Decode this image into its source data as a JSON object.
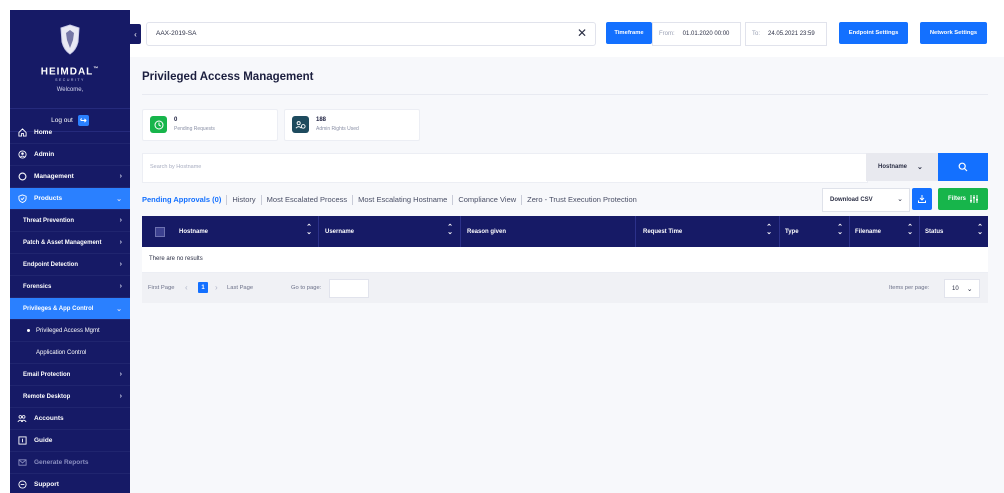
{
  "sidebar": {
    "brand": "HEIMDAL",
    "brand_tm": "™",
    "brand_sub": "SECURITY",
    "welcome": "Welcome,",
    "logout": "Log out",
    "items": [
      {
        "label": "Home",
        "icon": "home-icon"
      },
      {
        "label": "Admin",
        "icon": "admin-icon"
      },
      {
        "label": "Management",
        "icon": "management-icon"
      },
      {
        "label": "Products",
        "icon": "shield-icon"
      },
      {
        "label": "Threat Prevention"
      },
      {
        "label": "Patch & Asset Management"
      },
      {
        "label": "Endpoint Detection"
      },
      {
        "label": "Forensics"
      },
      {
        "label": "Privileges & App Control"
      },
      {
        "label": "Privileged Access Mgmt"
      },
      {
        "label": "Application Control"
      },
      {
        "label": "Email Protection"
      },
      {
        "label": "Remote Desktop"
      },
      {
        "label": "Accounts",
        "icon": "accounts-icon"
      },
      {
        "label": "Guide",
        "icon": "guide-icon"
      },
      {
        "label": "Generate Reports",
        "icon": "mail-icon"
      },
      {
        "label": "Support",
        "icon": "chat-icon"
      }
    ]
  },
  "topbar": {
    "hostname_value": "AAX-2019-SA",
    "timeframe": "Timeframe",
    "from_label": "From:",
    "from_value": "01.01.2020 00:00",
    "to_label": "To:",
    "to_value": "24.05.2021 23:59",
    "endpoint_settings": "Endpoint Settings",
    "network_settings": "Network Settings"
  },
  "page": {
    "title": "Privileged Access Management"
  },
  "stats": [
    {
      "value": "0",
      "label": "Pending Requests",
      "color": "#17b54b"
    },
    {
      "value": "188",
      "label": "Admin Rights Used",
      "color": "#1e4b5e"
    }
  ],
  "search": {
    "placeholder": "Search by Hostname",
    "field": "Hostname"
  },
  "tabs": [
    "Pending Approvals (0)",
    "History",
    "Most Escalated Process",
    "Most Escalating Hostname",
    "Compliance View",
    "Zero - Trust Execution Protection"
  ],
  "actions": {
    "download_csv": "Download CSV",
    "filters": "Filters"
  },
  "table": {
    "columns": [
      "Hostname",
      "Username",
      "Reason given",
      "Request Time",
      "Type",
      "Filename",
      "Status"
    ],
    "empty": "There are no results"
  },
  "pager": {
    "first": "First Page",
    "page": "1",
    "last": "Last Page",
    "goto": "Go to page:",
    "ipp_label": "Items per page:",
    "ipp_value": "10"
  },
  "colors": {
    "navy": "#161a66",
    "accent": "#1370ff",
    "green": "#17b54b"
  }
}
